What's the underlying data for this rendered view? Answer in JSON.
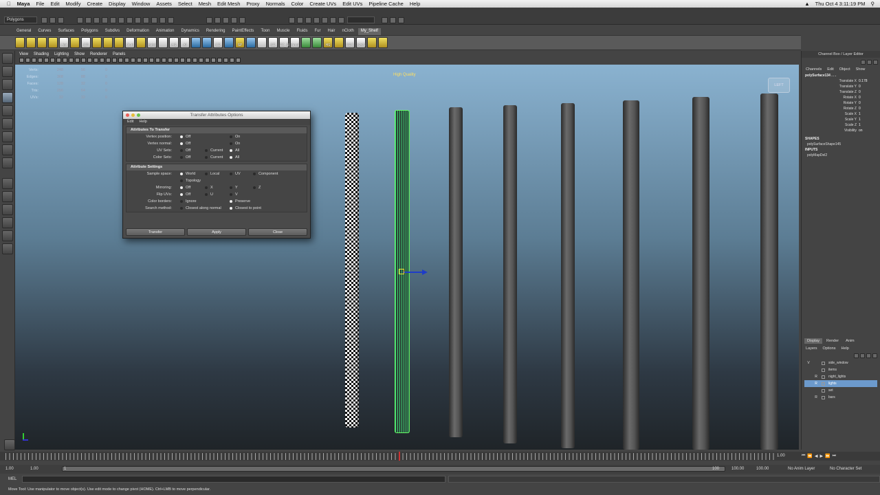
{
  "macmenu": {
    "app": "Maya",
    "items": [
      "File",
      "Edit",
      "Modify",
      "Create",
      "Display",
      "Window",
      "Assets",
      "Select",
      "Mesh",
      "Edit Mesh",
      "Proxy",
      "Normals",
      "Color",
      "Create UVs",
      "Edit UVs",
      "Pipeline Cache",
      "Help"
    ],
    "clock": "Thu Oct 4  3:11:19 PM"
  },
  "status": {
    "mode": "Polygons"
  },
  "shelf_tabs": [
    "General",
    "Curves",
    "Surfaces",
    "Polygons",
    "Subdivs",
    "Deformation",
    "Animation",
    "Dynamics",
    "Rendering",
    "PaintEffects",
    "Toon",
    "Muscle",
    "Fluids",
    "Fur",
    "Hair",
    "nCloth",
    "My_Shelf"
  ],
  "shelf_icons": [
    {
      "label": "",
      "color": "y"
    },
    {
      "label": "",
      "color": "y"
    },
    {
      "label": "",
      "color": "y"
    },
    {
      "label": "",
      "color": "y"
    },
    {
      "label": "Hist",
      "color": "w"
    },
    {
      "label": "",
      "color": "y"
    },
    {
      "label": "CP",
      "color": "w"
    },
    {
      "label": "",
      "color": "y"
    },
    {
      "label": "",
      "color": "y"
    },
    {
      "label": "",
      "color": "y"
    },
    {
      "label": "Outl",
      "color": "w"
    },
    {
      "label": "",
      "color": "y"
    },
    {
      "label": "Hshd",
      "color": "w"
    },
    {
      "label": "",
      "color": "w"
    },
    {
      "label": "HS",
      "color": "w"
    },
    {
      "label": "All",
      "color": "w"
    },
    {
      "label": "",
      "color": "b"
    },
    {
      "label": "",
      "color": "b"
    },
    {
      "label": "CE",
      "color": "w"
    },
    {
      "label": "",
      "color": "b"
    },
    {
      "label": "SP",
      "color": "y"
    },
    {
      "label": "",
      "color": "b"
    },
    {
      "label": "",
      "color": "w"
    },
    {
      "label": "SE",
      "color": "w"
    },
    {
      "label": "EZ_Sl",
      "color": "w"
    },
    {
      "label": "decal",
      "color": "w"
    },
    {
      "label": "",
      "color": "g"
    },
    {
      "label": "",
      "color": "g"
    },
    {
      "label": "HS",
      "color": "y"
    },
    {
      "label": "",
      "color": "y"
    },
    {
      "label": "REC",
      "color": "w"
    },
    {
      "label": "MAIN",
      "color": "w"
    },
    {
      "label": "",
      "color": "y"
    },
    {
      "label": "",
      "color": "y"
    }
  ],
  "viewport_menu": [
    "View",
    "Shading",
    "Lighting",
    "Show",
    "Renderer",
    "Panels"
  ],
  "hud": [
    {
      "k": "Verts:",
      "a": "248",
      "b": "56",
      "c": "0"
    },
    {
      "k": "Edges:",
      "a": "368",
      "b": "88",
      "c": "0"
    },
    {
      "k": "Faces:",
      "a": "128",
      "b": "32",
      "c": "0"
    },
    {
      "k": "Tris:",
      "a": "256",
      "b": "64",
      "c": "0"
    },
    {
      "k": "UVs:",
      "a": "32",
      "b": "32",
      "c": "0"
    }
  ],
  "viewport_label": "High Quality",
  "cam_label": "LEFT",
  "dialog": {
    "title": "Transfer Attributes Options",
    "menu": [
      "Edit",
      "Help"
    ],
    "frame1": "Attributes To Transfer",
    "rows1": [
      {
        "label": "Vertex position:",
        "opts": [
          "Off",
          "",
          "On"
        ]
      },
      {
        "label": "Vertex normal:",
        "opts": [
          "Off",
          "",
          "On"
        ]
      },
      {
        "label": "UV Sets:",
        "opts": [
          "Off",
          "Current",
          "All"
        ]
      },
      {
        "label": "Color Sets:",
        "opts": [
          "Off",
          "Current",
          "All"
        ]
      }
    ],
    "frame2": "Attribute Settings",
    "sample_label": "Sample space:",
    "sample_opts": [
      "World",
      "Local",
      "UV",
      "Component",
      "Topology"
    ],
    "mirror_label": "Mirroring:",
    "mirror_opts": [
      "Off",
      "X",
      "Y",
      "Z"
    ],
    "flip_label": "Flip UVs:",
    "flip_opts": [
      "Off",
      "U",
      "V"
    ],
    "border_label": "Color borders:",
    "border_opts": [
      "Ignore",
      "Preserve"
    ],
    "search_label": "Search method:",
    "search_opts": [
      "Closest along normal",
      "Closest to point"
    ],
    "buttons": [
      "Transfer",
      "Apply",
      "Close"
    ]
  },
  "channel_box": {
    "title": "Channel Box / Layer Editor",
    "menu": [
      "Channels",
      "Edit",
      "Object",
      "Show"
    ],
    "object": "polySurface134 . . .",
    "attrs": [
      {
        "n": "Translate X",
        "v": "0.178"
      },
      {
        "n": "Translate Y",
        "v": "0"
      },
      {
        "n": "Translate Z",
        "v": "0"
      },
      {
        "n": "Rotate X",
        "v": "0"
      },
      {
        "n": "Rotate Y",
        "v": "0"
      },
      {
        "n": "Rotate Z",
        "v": "0"
      },
      {
        "n": "Scale X",
        "v": "1"
      },
      {
        "n": "Scale Y",
        "v": "1"
      },
      {
        "n": "Scale Z",
        "v": "1"
      },
      {
        "n": "Visibility",
        "v": "on"
      }
    ],
    "shapes_head": "SHAPES",
    "shape": "polySurfaceShape145",
    "inputs_head": "INPUTS",
    "input": "polyMapDel2"
  },
  "layer_editor": {
    "tabs": [
      "Display",
      "Render",
      "Anim"
    ],
    "menu": [
      "Layers",
      "Options",
      "Help"
    ],
    "layers": [
      {
        "c1": "V",
        "c2": "",
        "name": "side_window",
        "sel": false
      },
      {
        "c1": "",
        "c2": "",
        "name": "items",
        "sel": false
      },
      {
        "c1": "",
        "c2": "R",
        "name": "night_lights",
        "sel": false
      },
      {
        "c1": "",
        "c2": "R",
        "name": "lights",
        "sel": true
      },
      {
        "c1": "",
        "c2": "",
        "name": "set",
        "sel": false
      },
      {
        "c1": "",
        "c2": "R",
        "name": "bars",
        "sel": false
      }
    ]
  },
  "timeline": {
    "end_frame": "1.00"
  },
  "range": {
    "start": "1.00",
    "inner_start": "1.00",
    "current": "1",
    "inner_end": "100",
    "end1": "100.00",
    "end2": "100.00",
    "anim_layer": "No Anim Layer",
    "char_set": "No Character Set"
  },
  "cmdline": {
    "label": "MEL"
  },
  "helpline": "Move Tool: Use manipulator to move object(s). Use edit mode to change pivot (HOME). Ctrl+LMB to move perpendicular."
}
